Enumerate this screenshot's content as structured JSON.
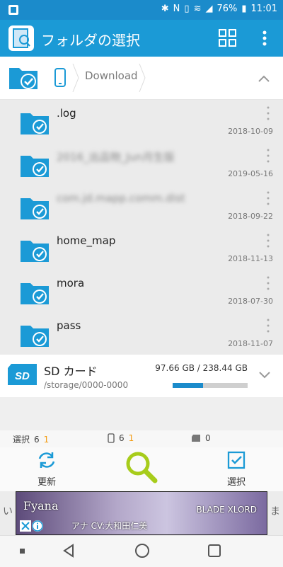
{
  "status": {
    "battery": "76%",
    "time": "11:01"
  },
  "app": {
    "title": "フォルダの選択"
  },
  "path": {
    "current": "Download"
  },
  "folders": [
    {
      "name": ".log",
      "date": "2018-10-09",
      "blur": false
    },
    {
      "name": "2016_出品物_Jun月生版",
      "date": "2019-05-16",
      "blur": true
    },
    {
      "name": "com.jd.mapp.comm.dist",
      "date": "2018-09-22",
      "blur": true
    },
    {
      "name": "home_map",
      "date": "2018-11-13",
      "blur": false
    },
    {
      "name": "mora",
      "date": "2018-07-30",
      "blur": false
    },
    {
      "name": "pass",
      "date": "2018-11-07",
      "blur": false
    }
  ],
  "sd": {
    "title": "SD カード",
    "path": "/storage/0000-0000",
    "size": "97.66 GB / 238.44 GB",
    "used_fraction": 0.41
  },
  "counts": {
    "selected_label": "選択",
    "selected_count": "6",
    "selected_extra": "1",
    "device_count": "6",
    "device_extra": "1",
    "sd_count": "0"
  },
  "actions": {
    "refresh_label": "更新",
    "select_label": "選択"
  },
  "ad": {
    "brand": "Fyana",
    "sub": "アナ   CV:大和田仁美",
    "logo": "BLADE XLORD",
    "side_left": "い",
    "side_right": "ま"
  },
  "colors": {
    "brand": "#1b9ad6",
    "statusbar": "#1b8bcb",
    "accent_lime": "#a7cc1b",
    "orange": "#f39c12"
  }
}
